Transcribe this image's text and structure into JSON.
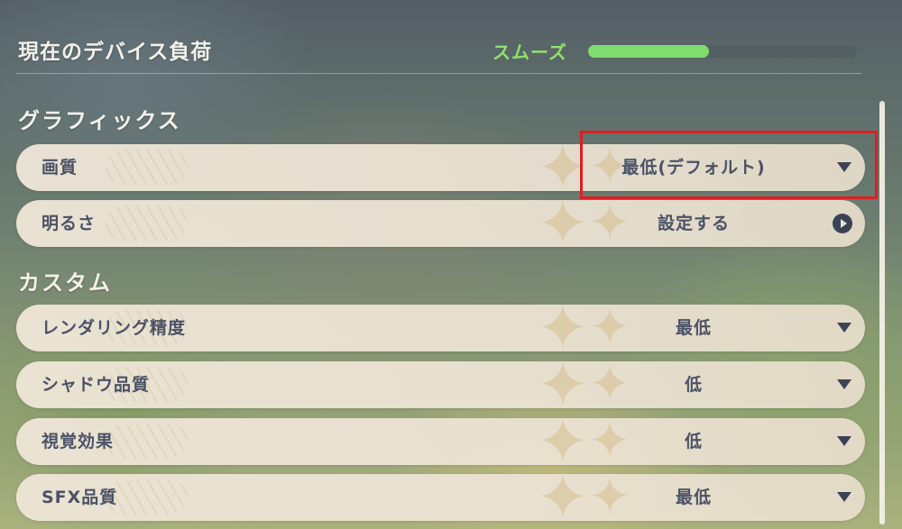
{
  "device_load": {
    "title": "現在のデバイス負荷",
    "status": "スムーズ",
    "level": 0.45,
    "status_color": "#8fe06b"
  },
  "sections": {
    "graphics": "グラフィックス",
    "custom": "カスタム"
  },
  "settings": {
    "quality": {
      "label": "画質",
      "value": "最低(デフォルト)",
      "control": "dropdown"
    },
    "brightness": {
      "label": "明るさ",
      "value": "設定する",
      "control": "arrow-icon"
    },
    "render_precision": {
      "label": "レンダリング精度",
      "value": "最低",
      "control": "dropdown"
    },
    "shadow_quality": {
      "label": "シャドウ品質",
      "value": "低",
      "control": "dropdown"
    },
    "visual_effects": {
      "label": "視覚効果",
      "value": "低",
      "control": "dropdown"
    },
    "sfx_quality": {
      "label": "SFX品質",
      "value": "最低",
      "control": "dropdown"
    }
  },
  "colors": {
    "text_dark": "#4b5266",
    "highlight": "#e01c22",
    "row_bg": "#ece3d4"
  }
}
